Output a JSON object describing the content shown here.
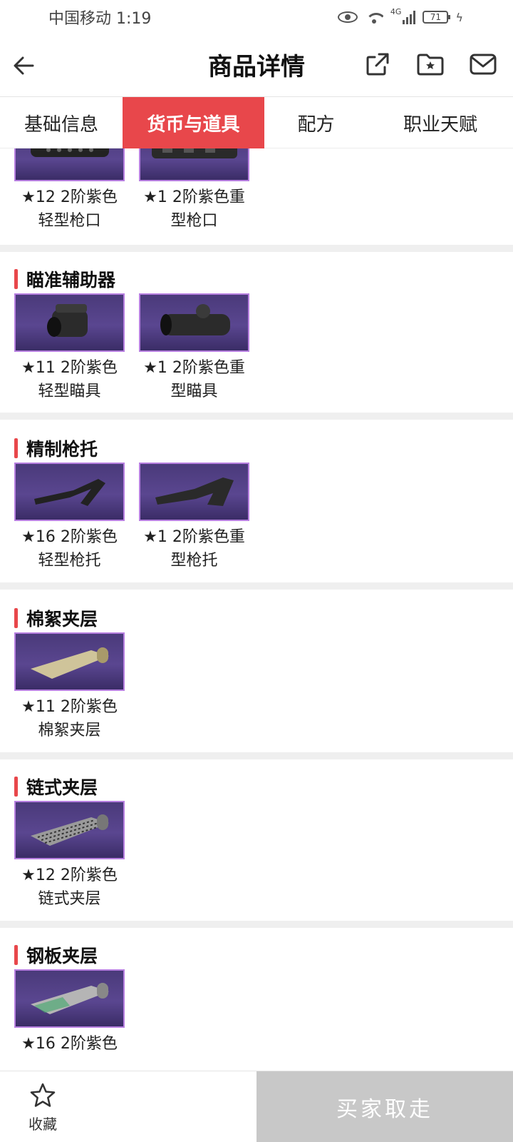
{
  "status_bar": {
    "carrier_time": "中国移动 1:19",
    "network": "4G",
    "battery": "71"
  },
  "header": {
    "title": "商品详情",
    "icons": [
      "back-arrow-icon",
      "share-icon",
      "favorites-folder-icon",
      "message-icon"
    ]
  },
  "tabs": [
    {
      "label": "基础信息"
    },
    {
      "label": "货币与道具"
    },
    {
      "label": "配方"
    },
    {
      "label": "职业天赋"
    }
  ],
  "sections": [
    {
      "title": "",
      "items": [
        {
          "line1": "★12 2阶紫色",
          "line2": "轻型枪口"
        },
        {
          "line1": "★1 2阶紫色重",
          "line2": "型枪口"
        }
      ]
    },
    {
      "title": "瞄准辅助器",
      "items": [
        {
          "line1": "★11 2阶紫色",
          "line2": "轻型瞄具"
        },
        {
          "line1": "★1 2阶紫色重",
          "line2": "型瞄具"
        }
      ]
    },
    {
      "title": "精制枪托",
      "items": [
        {
          "line1": "★16 2阶紫色",
          "line2": "轻型枪托"
        },
        {
          "line1": "★1 2阶紫色重",
          "line2": "型枪托"
        }
      ]
    },
    {
      "title": "棉絮夹层",
      "items": [
        {
          "line1": "★11 2阶紫色",
          "line2": "棉絮夹层"
        }
      ]
    },
    {
      "title": "链式夹层",
      "items": [
        {
          "line1": "★12 2阶紫色",
          "line2": "链式夹层"
        }
      ]
    },
    {
      "title": "钢板夹层",
      "items": [
        {
          "line1": "★16 2阶紫色",
          "line2": ""
        }
      ]
    }
  ],
  "bottom": {
    "favorite_label": "收藏",
    "buyer_button_label": "买家取走"
  },
  "colors": {
    "accent": "#e8474b",
    "item_bg": "#4a3a7a",
    "item_border": "#b77fe0",
    "disabled_button": "#c8c8c8"
  }
}
